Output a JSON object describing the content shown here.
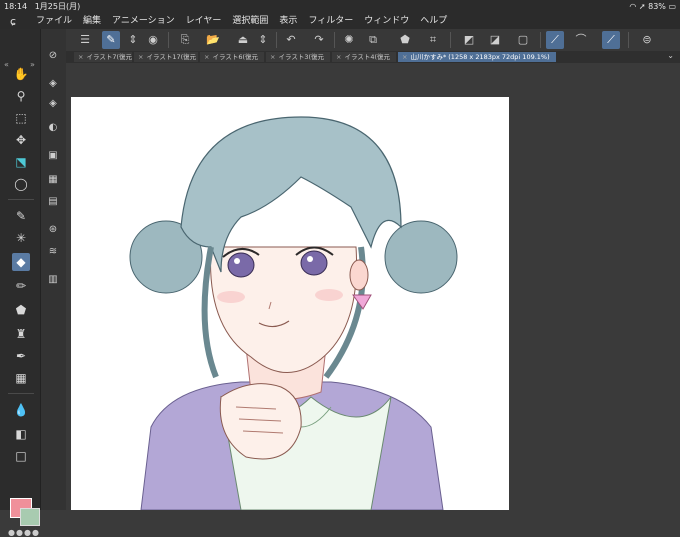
{
  "status": {
    "time": "18:14",
    "date": "1月25日(月)",
    "battery": "83%"
  },
  "menu": {
    "items": [
      "ファイル",
      "編集",
      "アニメーション",
      "レイヤー",
      "選択範囲",
      "表示",
      "フィルター",
      "ウィンドウ",
      "ヘルプ"
    ]
  },
  "tabs": [
    {
      "label": "イラスト7(復元"
    },
    {
      "label": "イラスト17(復元"
    },
    {
      "label": "イラスト6(復元"
    },
    {
      "label": "イラスト3(復元"
    },
    {
      "label": "イラスト4(復元"
    },
    {
      "label": "山川かすみ* (1258 x 2183px 72dpi 109.1%)"
    }
  ],
  "colors": {
    "main_color": "#f0909a",
    "sub_color": "#a8cbb0",
    "accent": "#4f6f96"
  },
  "tools": [
    "hand-icon",
    "zoom-icon",
    "operation-icon",
    "move-icon",
    "selection-icon",
    "lasso-icon",
    "eyedropper-icon",
    "auto-select-icon",
    "eraser-icon",
    "pencil-icon",
    "fill-icon",
    "brush-icon",
    "pen-icon",
    "texture-icon",
    "blend-icon",
    "gradient-icon",
    "figure-icon"
  ],
  "subtools": [
    "view-rotate-icon",
    "layer-icon",
    "layer-clear-icon",
    "layer-lock-icon",
    "flip-icon",
    "grid-icon",
    "layer-stack-icon",
    "folder-layer-icon",
    "table-icon"
  ]
}
